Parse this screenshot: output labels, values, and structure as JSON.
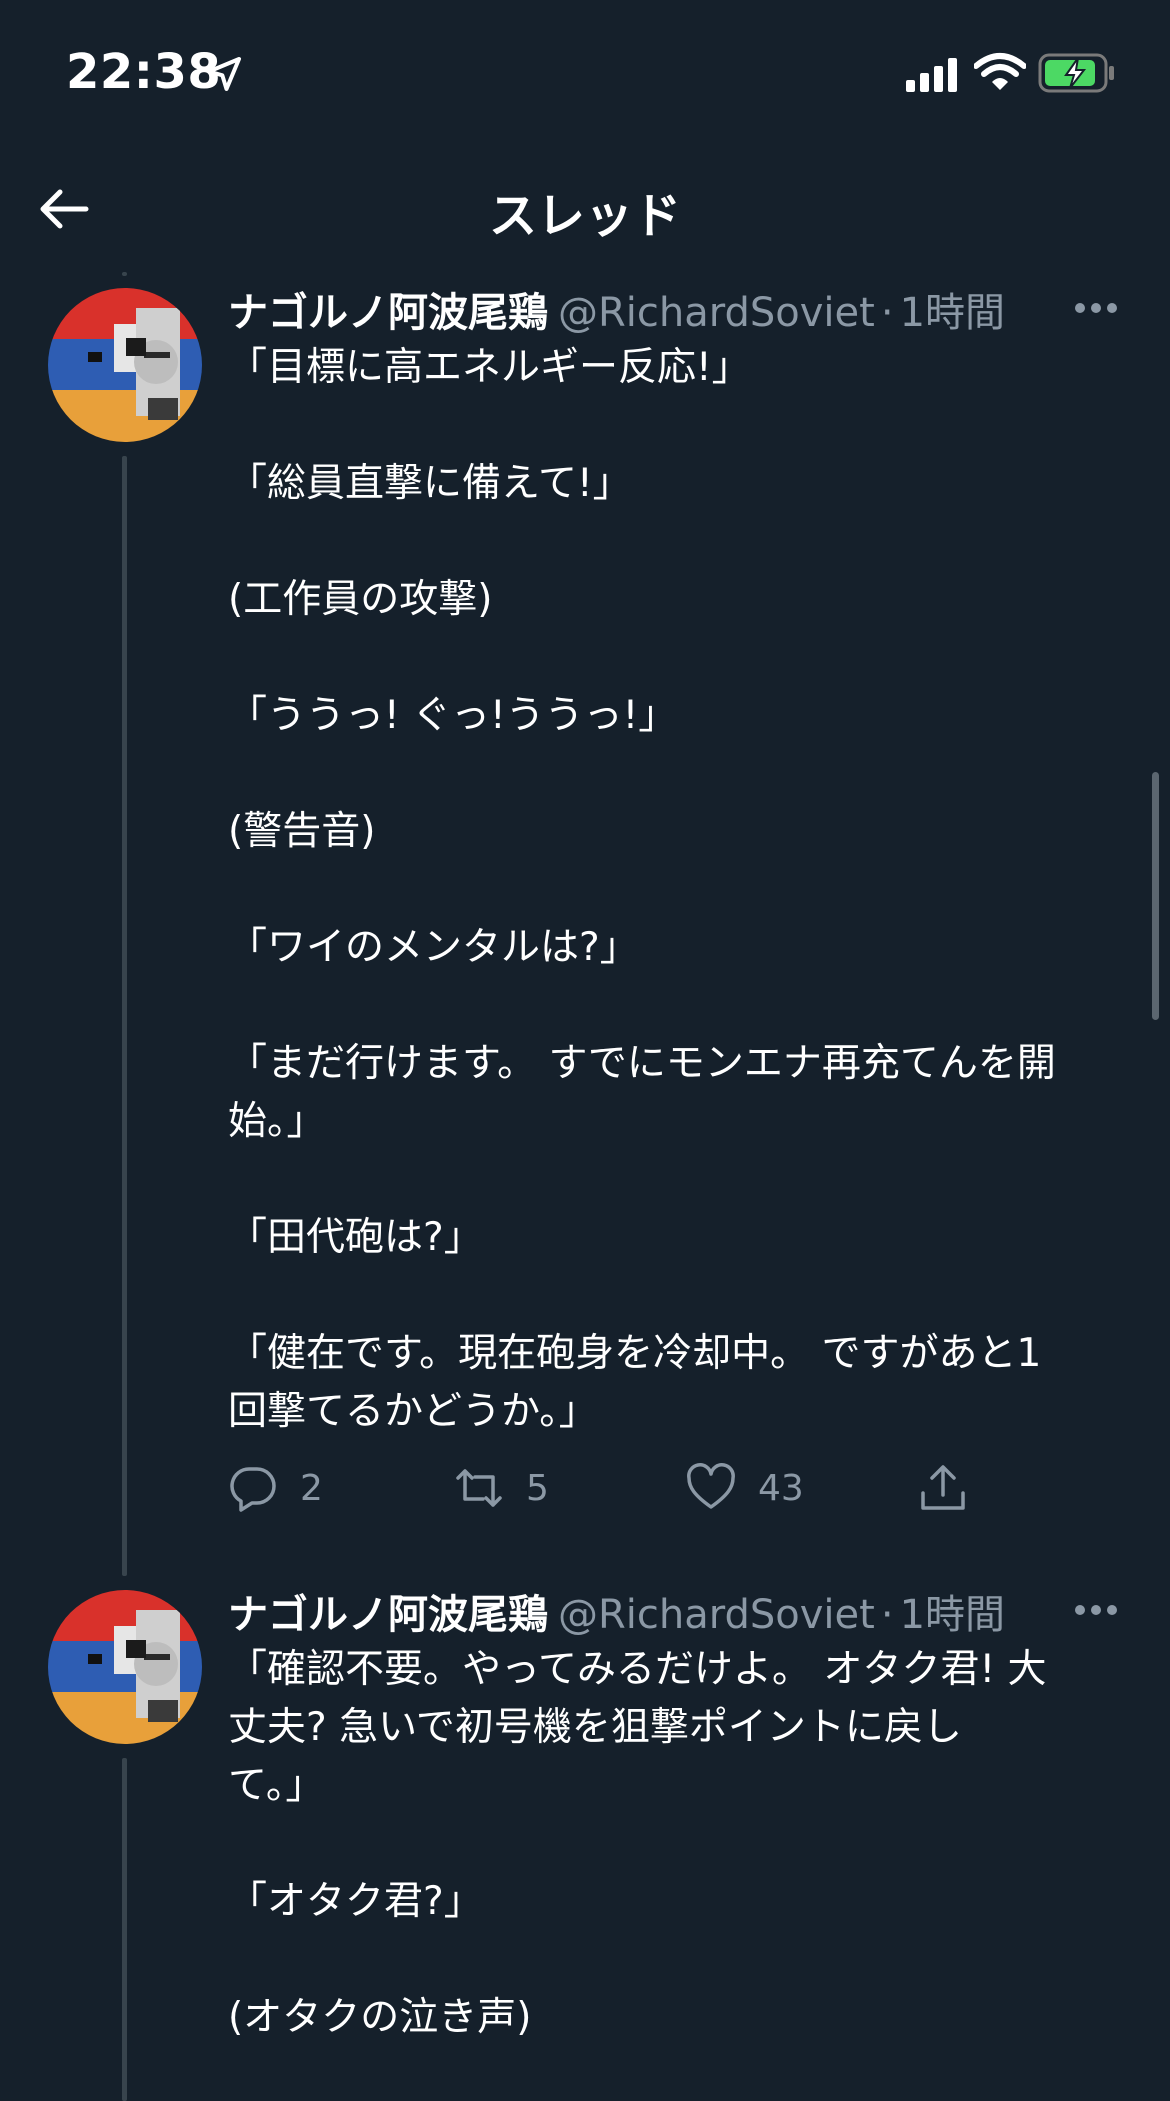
{
  "status_bar": {
    "time": "22:38",
    "icons": [
      "location-arrow-icon",
      "cellular-signal-icon",
      "wifi-icon",
      "battery-charging-icon"
    ]
  },
  "nav": {
    "back_icon": "arrow-left-icon",
    "title": "スレッド"
  },
  "colors": {
    "background": "#15202b",
    "text_primary": "#ffffff",
    "text_secondary": "#8b98a5",
    "thread_line": "#38444d",
    "battery_green": "#4cd964"
  },
  "tweets": [
    {
      "name": "ナゴルノ阿波尾鶏",
      "handle": "@RichardSoviet",
      "dot": "·",
      "time": "1時間",
      "lines": [
        "「目標に高エネルギー反応!」",
        "",
        "「総員直撃に備えて!」",
        "",
        "(工作員の攻撃)",
        "",
        "「ううっ! ぐっ!ううっ!」",
        "",
        "(警告音)",
        "",
        "「ワイのメンタルは?」",
        "",
        "「まだ行けます。 すでにモンエナ再充てんを開",
        "始。」",
        "",
        "「田代砲は?」",
        "",
        "「健在です。現在砲身を冷却中。 ですがあと1",
        "回撃てるかどうか。」"
      ],
      "actions": {
        "reply": "2",
        "retweet": "5",
        "like": "43"
      }
    },
    {
      "name": "ナゴルノ阿波尾鶏",
      "handle": "@RichardSoviet",
      "dot": "·",
      "time": "1時間",
      "lines": [
        "「確認不要。やってみるだけよ。 オタク君! 大",
        "丈夫? 急いで初号機を狙撃ポイントに戻し",
        "て。」",
        "",
        "「オタク君?」",
        "",
        "(オタクの泣き声)"
      ]
    }
  ]
}
